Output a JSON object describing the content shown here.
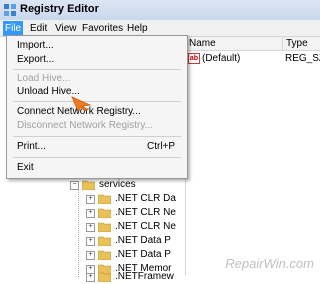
{
  "window": {
    "title": "Registry Editor"
  },
  "menubar": {
    "items": [
      {
        "label": "File",
        "active": true
      },
      {
        "label": "Edit"
      },
      {
        "label": "View"
      },
      {
        "label": "Favorites"
      },
      {
        "label": "Help"
      }
    ]
  },
  "file_menu": {
    "items": [
      {
        "label": "Import...",
        "enabled": true
      },
      {
        "label": "Export...",
        "enabled": true
      },
      {
        "label": "Load Hive...",
        "enabled": false
      },
      {
        "label": "Unload Hive...",
        "enabled": true
      },
      {
        "label": "Connect Network Registry...",
        "enabled": true
      },
      {
        "label": "Disconnect Network Registry...",
        "enabled": false
      },
      {
        "label": "Print...",
        "shortcut": "Ctrl+P",
        "enabled": true
      },
      {
        "label": "Exit",
        "enabled": true
      }
    ]
  },
  "values_list": {
    "columns": [
      "Name",
      "Type"
    ],
    "rows": [
      {
        "name": "(Default)",
        "type": "REG_SZ",
        "icon": "ab"
      }
    ]
  },
  "tree": {
    "services": "services",
    "children": [
      ".NET CLR Da",
      ".NET CLR Ne",
      ".NET CLR Ne",
      ".NET Data P",
      ".NET Data P",
      ".NET Memor",
      ".NETFramew"
    ]
  },
  "watermark": "RepairWin.com",
  "colors": {
    "menu_highlight": "#3399ff",
    "folder": "#e8c15a",
    "arrow": "#f07a20"
  }
}
